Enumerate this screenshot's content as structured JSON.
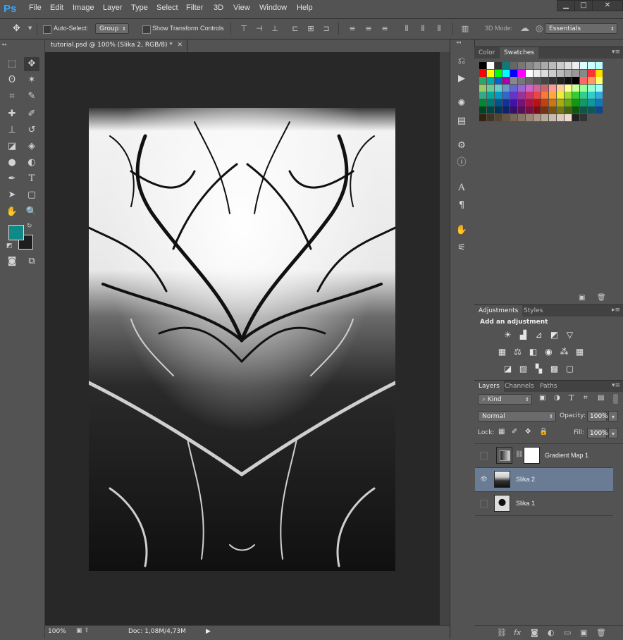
{
  "app": {
    "logo": "Ps"
  },
  "menu": [
    "File",
    "Edit",
    "Image",
    "Layer",
    "Type",
    "Select",
    "Filter",
    "3D",
    "View",
    "Window",
    "Help"
  ],
  "window_controls": {
    "minimize": "▁",
    "maximize": "□",
    "close": "✕"
  },
  "options": {
    "auto_select_label": "Auto-Select:",
    "auto_select_value": "Group",
    "transform_label": "Show Transform Controls",
    "mode_3d_label": "3D Mode:",
    "workspace_value": "Essentials"
  },
  "document": {
    "tab_title": "tutorial.psd @ 100% (Slika 2, RGB/8) *",
    "zoom": "100%",
    "doc_info": "Doc: 1,08M/4,73M"
  },
  "swatches_panel": {
    "tabs": [
      "Color",
      "Swatches"
    ],
    "active_tab": "Swatches"
  },
  "adjustments_panel": {
    "tabs": [
      "Adjustments",
      "Styles"
    ],
    "heading": "Add an adjustment"
  },
  "layers_panel": {
    "tabs": [
      "Layers",
      "Channels",
      "Paths"
    ],
    "filter_kind": "Kind",
    "blend_mode": "Normal",
    "opacity_label": "Opacity:",
    "opacity_value": "100%",
    "lock_label": "Lock:",
    "fill_label": "Fill:",
    "fill_value": "100%",
    "layers": [
      {
        "name": "Gradient Map 1",
        "visible": false,
        "selected": false
      },
      {
        "name": "Slika 2",
        "visible": true,
        "selected": true
      },
      {
        "name": "Slika 1",
        "visible": false,
        "selected": false
      }
    ]
  },
  "colors": {
    "foreground": "#0f8a86",
    "background": "#1e1e1e",
    "selection": "#6a7c94"
  }
}
